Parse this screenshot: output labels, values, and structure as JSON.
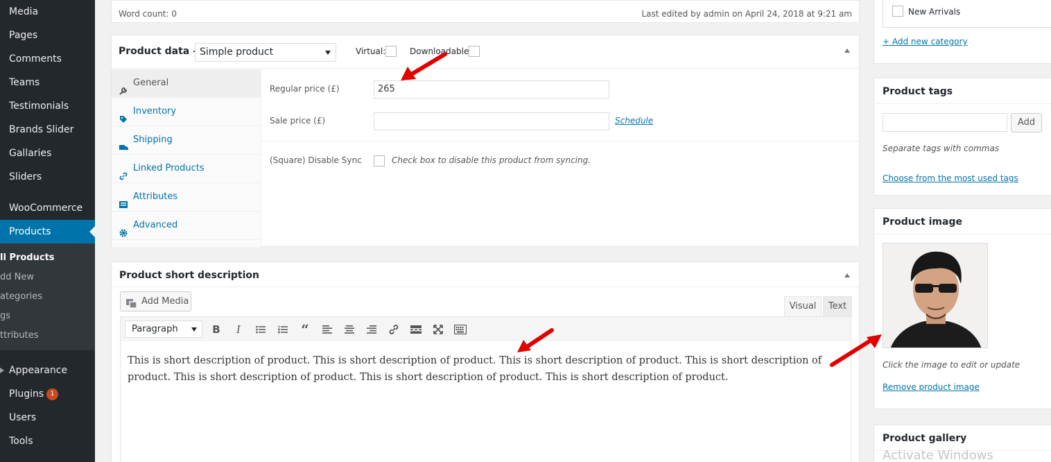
{
  "sidebar": {
    "items": [
      {
        "label": "Media"
      },
      {
        "label": "Pages"
      },
      {
        "label": "Comments"
      },
      {
        "label": "Teams"
      },
      {
        "label": "Testimonials"
      },
      {
        "label": "Brands Slider"
      },
      {
        "label": "Gallaries"
      },
      {
        "label": "Sliders"
      },
      {
        "label": "WooCommerce"
      },
      {
        "label": "Products"
      },
      {
        "label": "Appearance"
      },
      {
        "label": "Plugins",
        "badge": "1"
      },
      {
        "label": "Users"
      },
      {
        "label": "Tools"
      }
    ],
    "submenu": [
      "ll Products",
      "dd New",
      "ategories",
      "gs",
      "ttributes"
    ]
  },
  "status": {
    "word_count": "Word count: 0",
    "last_edited": "Last edited by admin on April 24, 2018 at 9:21 am"
  },
  "product_data": {
    "title": "Product data —",
    "type_selected": "Simple product",
    "virtual_label": "Virtual:",
    "downloadable_label": "Downloadable:",
    "tabs": [
      "General",
      "Inventory",
      "Shipping",
      "Linked Products",
      "Attributes",
      "Advanced"
    ],
    "regular_price_label": "Regular price (£)",
    "regular_price_value": "265",
    "sale_price_label": "Sale price (£)",
    "sale_price_value": "",
    "schedule_link": "Schedule",
    "square_label": "(Square) Disable Sync",
    "square_desc": "Check box to disable this product from syncing."
  },
  "short_description": {
    "title": "Product short description",
    "add_media": "Add Media",
    "tab_visual": "Visual",
    "tab_text": "Text",
    "format": "Paragraph",
    "content": "This is short description of product. This is short description of product. This is short description of product. This is short description of product. This is short description of product. This is short description of product. This is short description of product."
  },
  "categories": {
    "item": "New Arrivals",
    "add_link": "+ Add new category"
  },
  "tags": {
    "title": "Product tags",
    "input_value": "",
    "add_button": "Add",
    "hint": "Separate tags with commas",
    "choose_link": "Choose from the most used tags"
  },
  "product_image": {
    "title": "Product image",
    "hint": "Click the image to edit or update",
    "remove_link": "Remove product image"
  },
  "gallery": {
    "title": "Product gallery"
  },
  "watermark": "Activate Windows",
  "colors": {
    "sidebar": "#23282d",
    "accent": "#0073aa",
    "arrow": "#e00000"
  }
}
